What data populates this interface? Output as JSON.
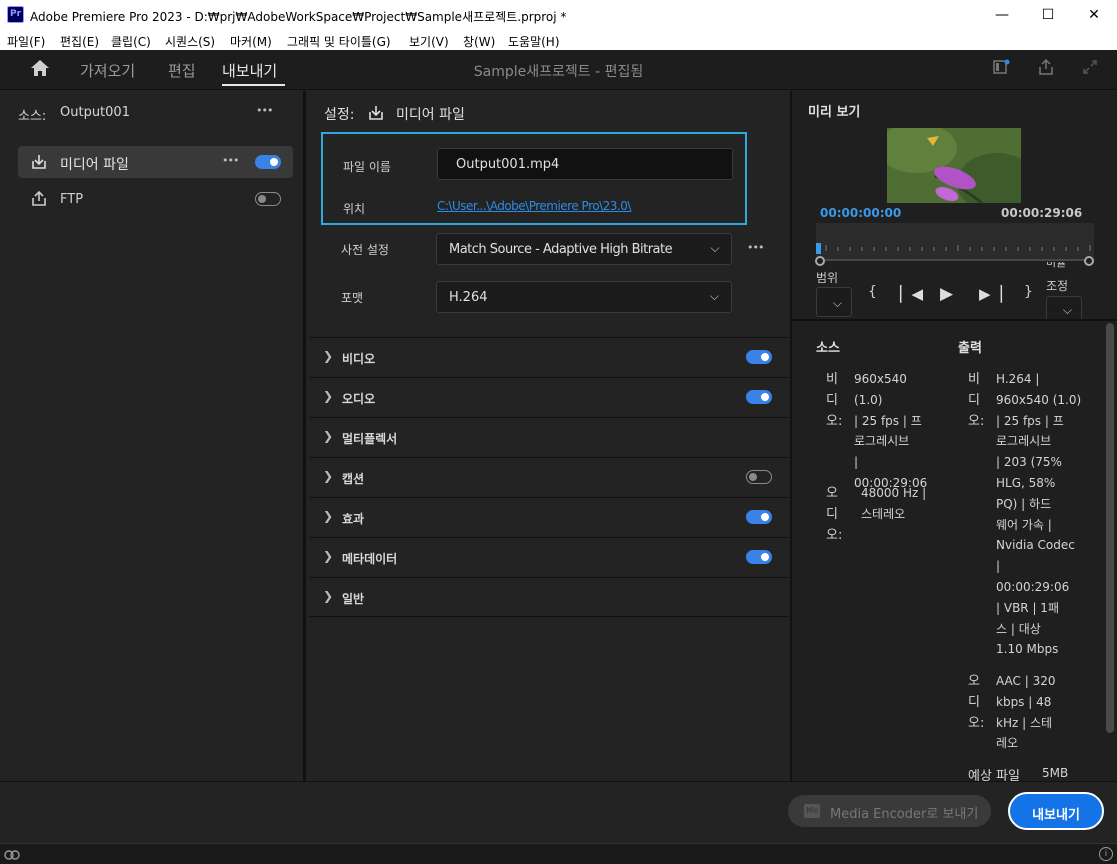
{
  "window": {
    "app_icon": "Pr",
    "title": "Adobe Premiere Pro 2023 - D:₩prj₩AdobeWorkSpace₩Project₩Sample새프로젝트.prproj *",
    "minimize": "—",
    "maximize": "☐",
    "close": "✕"
  },
  "menu": [
    "파일(F)",
    "편집(E)",
    "클립(C)",
    "시퀀스(S)",
    "마커(M)",
    "그래픽 및 타이틀(G)",
    "보기(V)",
    "창(W)",
    "도움말(H)"
  ],
  "header": {
    "tabs": [
      "가져오기",
      "편집",
      "내보내기"
    ],
    "active_tab": "내보내기",
    "project_title": "Sample새프로젝트 - 편집됨"
  },
  "left": {
    "source_label": "소스:",
    "source_name": "Output001",
    "more": "•••",
    "destinations": [
      {
        "label": "미디어 파일",
        "enabled": true
      },
      {
        "label": "FTP",
        "enabled": false
      }
    ]
  },
  "settings": {
    "heading": "설정:",
    "destination": "미디어 파일",
    "file_name_label": "파일 이름",
    "file_name": "Output001.mp4",
    "location_label": "위치",
    "location": "C:\\User...\\Adobe\\Premiere Pro\\23.0\\",
    "preset_label": "사전 설정",
    "preset": "Match Source - Adaptive High Bitrate",
    "format_label": "포맷",
    "format": "H.264",
    "sections": [
      {
        "label": "비디오",
        "toggle": "on"
      },
      {
        "label": "오디오",
        "toggle": "on"
      },
      {
        "label": "멀티플렉서",
        "toggle": "none"
      },
      {
        "label": "캡션",
        "toggle": "off"
      },
      {
        "label": "효과",
        "toggle": "on"
      },
      {
        "label": "메타데이터",
        "toggle": "on"
      },
      {
        "label": "일반",
        "toggle": "none"
      }
    ]
  },
  "preview": {
    "title": "미리 보기",
    "time_start": "00:00:00:00",
    "time_end": "00:00:29:06",
    "range_label": "범위",
    "fit_label_top": "비율",
    "fit_label": "조정"
  },
  "summary": {
    "source_heading": "소스",
    "output_heading": "출력",
    "source_video_label": "비디오:",
    "source_video_lines": [
      "960x540 (1.0)",
      "| 25 fps | 프",
      "로그레시브",
      "|",
      "00:00:29:06"
    ],
    "source_audio_label": "오디오:",
    "source_audio_lines": [
      "48000 Hz |",
      "스테레오"
    ],
    "output_video_label": "비디오:",
    "output_video_lines": [
      "H.264 |",
      "960x540 (1.0)",
      "| 25 fps | 프",
      "로그레시브",
      "| 203 (75%",
      "HLG, 58%",
      "PQ) | 하드",
      "웨어 가속 |",
      "Nvidia Codec",
      "|",
      "00:00:29:06",
      "| VBR | 1패",
      "스 | 대상",
      "1.10 Mbps"
    ],
    "output_audio_label": "오디오:",
    "output_audio_lines": [
      "AAC | 320",
      "kbps | 48",
      "kHz | 스테",
      "레오"
    ],
    "file_size_label": "예상 파일",
    "file_size": "5MB"
  },
  "footer": {
    "media_encoder_label": "Media Encoder로 보내기",
    "media_encoder_icon": "Me",
    "export_label": "내보내기"
  },
  "colors": {
    "accent": "#1473e6",
    "focus": "#2fa8e0",
    "link": "#2e8ae6"
  }
}
